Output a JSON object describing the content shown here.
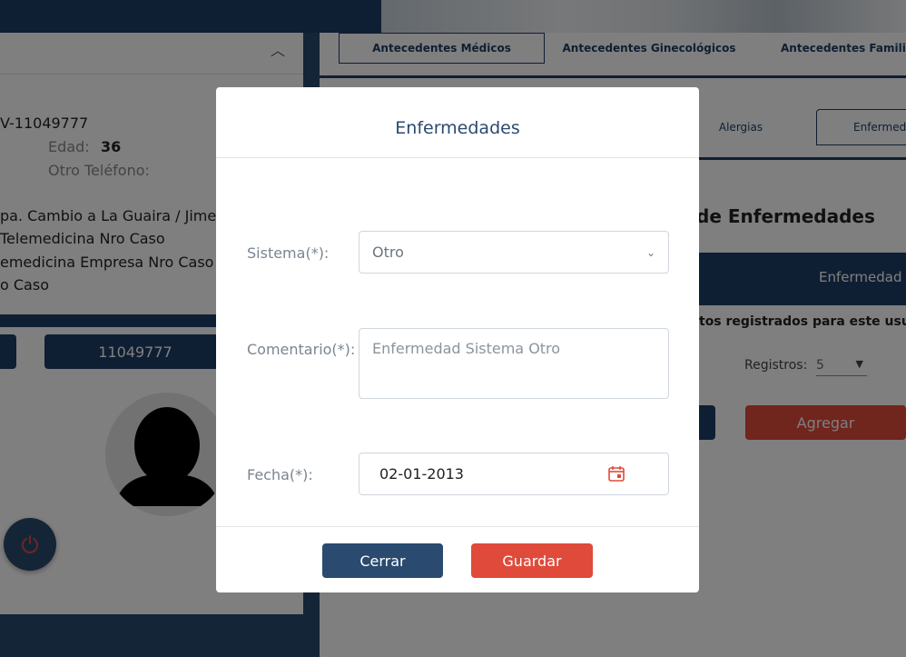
{
  "left_panel": {
    "patient_id": "V-11049777",
    "edad_label": "Edad:",
    "edad_value": "36",
    "otro_telefono_label": "Otro Teléfono:",
    "lines": [
      "pa. Cambio a La Guaira / Jime",
      " Telemedicina Nro Caso",
      "emedicina Empresa Nro Caso",
      "o Caso"
    ],
    "id_button": "11049777"
  },
  "right_panel": {
    "tabs": [
      "Antecedentes Médicos",
      "Antecedentes Ginecológicos",
      "Antecedentes Familiar"
    ],
    "subtabs": [
      "Alergias",
      "Enfermed"
    ],
    "title": "de Enfermedades",
    "table_header": "Enfermedad",
    "no_records": "tos registrados para este usuar",
    "registros_label": "Registros:",
    "registros_value": "5",
    "agregar_label": "Agregar"
  },
  "modal": {
    "title": "Enfermedades",
    "sistema_label": "Sistema(*):",
    "sistema_value": "Otro",
    "comentario_label": "Comentario(*):",
    "comentario_value": "Enfermedad Sistema Otro",
    "fecha_label": "Fecha(*):",
    "fecha_value": "02-01-2013",
    "cerrar_label": "Cerrar",
    "guardar_label": "Guardar"
  },
  "colors": {
    "primary": "#2a4a70",
    "danger": "#e04a3a",
    "navy": "#1e3f66"
  },
  "icons": [
    "chevron-up-icon",
    "chevron-down-icon",
    "calendar-icon",
    "power-icon",
    "avatar-silhouette"
  ]
}
